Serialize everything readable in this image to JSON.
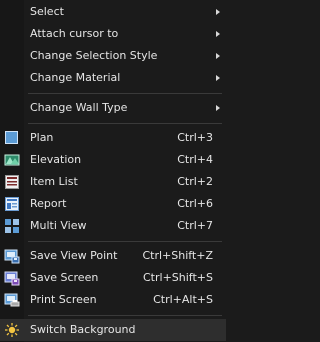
{
  "menu": {
    "items": [
      {
        "label": "Select",
        "submenu": true
      },
      {
        "label": "Attach cursor to",
        "submenu": true
      },
      {
        "label": "Change Selection Style",
        "submenu": true
      },
      {
        "label": "Change Material",
        "submenu": true
      },
      {
        "label": "Change Wall Type",
        "submenu": true
      },
      {
        "label": "Plan",
        "shortcut": "Ctrl+3",
        "icon": "plan-icon"
      },
      {
        "label": "Elevation",
        "shortcut": "Ctrl+4",
        "icon": "elevation-icon"
      },
      {
        "label": "Item List",
        "shortcut": "Ctrl+2",
        "icon": "item-list-icon"
      },
      {
        "label": "Report",
        "shortcut": "Ctrl+6",
        "icon": "report-icon"
      },
      {
        "label": "Multi View",
        "shortcut": "Ctrl+7",
        "icon": "multi-view-icon"
      },
      {
        "label": "Save View Point",
        "shortcut": "Ctrl+Shift+Z",
        "icon": "save-view-point-icon"
      },
      {
        "label": "Save Screen",
        "shortcut": "Ctrl+Shift+S",
        "icon": "save-screen-icon"
      },
      {
        "label": "Print Screen",
        "shortcut": "Ctrl+Alt+S",
        "icon": "print-screen-icon"
      },
      {
        "label": "Switch Background",
        "icon": "switch-background-icon"
      }
    ]
  }
}
